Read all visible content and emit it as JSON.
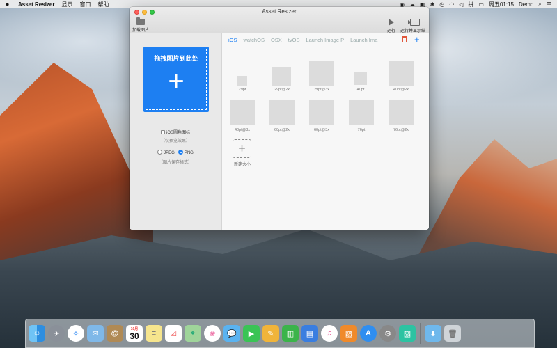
{
  "menubar": {
    "apple": "",
    "app_name": "Asset Resizer",
    "menus": [
      "显示",
      "窗口",
      "帮助"
    ],
    "clock": "周五01:15",
    "user": "Demo"
  },
  "window": {
    "title": "Asset Resizer",
    "toolbar": {
      "load_label": "加载图片",
      "run_label": "运行",
      "run_show_label": "运行并显示结果"
    }
  },
  "left": {
    "dropzone_label": "拖拽图片到此处",
    "dropzone_plus": "+",
    "ios_round_label": "iOS圆角图标",
    "ios_round_note": "（仅预览效果）",
    "format_jpeg": "JPEG",
    "format_png": "PNG",
    "format_selected": "PNG",
    "format_note": "（图片保存格式）"
  },
  "tabs": {
    "items": [
      "iOS",
      "watchOS",
      "OSX",
      "tvOS",
      "Launch Image P",
      "Launch Ima"
    ],
    "active": "iOS",
    "add": "+"
  },
  "sizes": [
    "29pt",
    "29pt@2x",
    "29pt@3x",
    "40pt",
    "40pt@2x",
    "40pt@3x",
    "60pt@2x",
    "60pt@3x",
    "76pt",
    "76pt@2x"
  ],
  "new_size": {
    "plus": "+",
    "label": "新建大小"
  },
  "dock": {
    "calendar_month": "10月",
    "calendar_day": "30",
    "icons": [
      "finder-icon",
      "launchpad-icon",
      "safari-icon",
      "mail-icon",
      "contacts-icon",
      "calendar-icon",
      "notes-icon",
      "reminders-icon",
      "maps-icon",
      "photos-icon",
      "messages-icon",
      "facetime-icon",
      "pages-icon",
      "numbers-icon",
      "keynote-icon",
      "itunes-icon",
      "ibooks-icon",
      "app-store-icon",
      "system-preferences-icon",
      "asset-resizer-icon",
      "downloads-folder-icon",
      "trash-icon"
    ]
  }
}
